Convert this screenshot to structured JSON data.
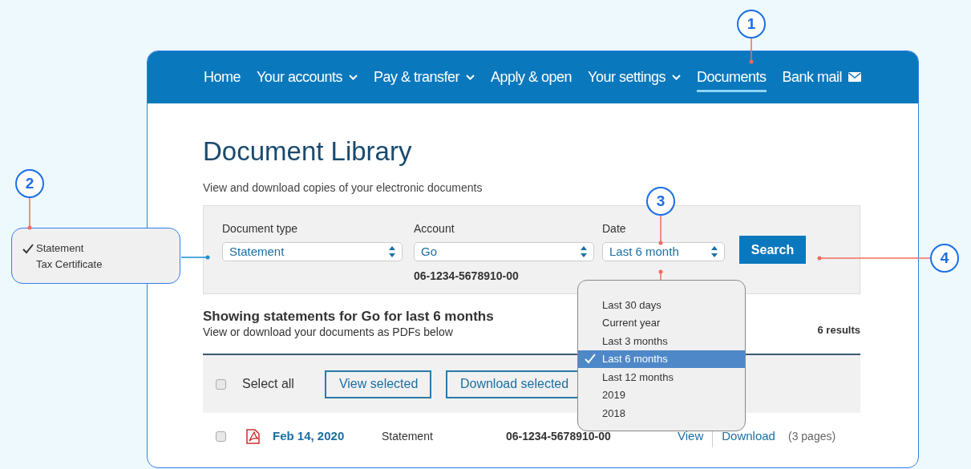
{
  "nav": [
    {
      "label": "Home",
      "kind": "link",
      "selected": false
    },
    {
      "label": "Your accounts",
      "kind": "menu",
      "selected": false
    },
    {
      "label": "Pay & transfer",
      "kind": "menu",
      "selected": false
    },
    {
      "label": "Apply & open",
      "kind": "link",
      "selected": false
    },
    {
      "label": "Your settings",
      "kind": "menu",
      "selected": false
    },
    {
      "label": "Documents",
      "kind": "link",
      "selected": true
    },
    {
      "label": "Bank mail",
      "kind": "mail",
      "selected": false
    }
  ],
  "title": "Document Library",
  "subtitle": "View and download copies of your electronic documents",
  "filters": {
    "document_type": {
      "label": "Document type",
      "value": "Statement"
    },
    "account": {
      "label": "Account",
      "value": "Go",
      "number": "06-1234-5678910-00"
    },
    "date": {
      "label": "Date",
      "value": "Last 6 month"
    },
    "search_button": "Search"
  },
  "results": {
    "heading": "Showing statements for Go for last 6 months",
    "note": "View or download your documents as PDFs below",
    "count": "6 results"
  },
  "toolbar": {
    "select_all": "Select all",
    "select_all_checked": false,
    "buttons": [
      "View selected",
      "Download selected"
    ]
  },
  "rows": [
    {
      "checked": false,
      "date": "Feb 14, 2020",
      "type": "Statement",
      "account": "06-1234-5678910-00",
      "view": "View",
      "download": "Download",
      "pages": "(3 pages)"
    }
  ],
  "date_dropdown": [
    {
      "label": "Last 30 days",
      "selected": false
    },
    {
      "label": "Current year",
      "selected": false
    },
    {
      "label": "Last 3 months",
      "selected": false
    },
    {
      "label": "Last 6 months",
      "selected": true
    },
    {
      "label": "Last 12 months",
      "selected": false
    },
    {
      "label": "2019",
      "selected": false
    },
    {
      "label": "2018",
      "selected": false
    }
  ],
  "document_type_popup": [
    {
      "label": "Statement",
      "selected": true
    },
    {
      "label": "Tax Certificate",
      "selected": false
    }
  ],
  "callouts": [
    "1",
    "2",
    "3",
    "4"
  ]
}
